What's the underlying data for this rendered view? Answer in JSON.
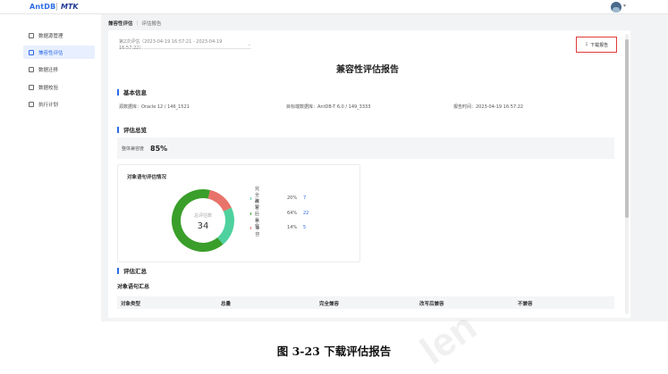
{
  "header": {
    "logo": "AntDB",
    "product": "MTK"
  },
  "sidebar": {
    "items": [
      {
        "label": "数据源管理",
        "icon": "database-icon",
        "active": false
      },
      {
        "label": "兼容性评估",
        "icon": "document-icon",
        "active": true
      },
      {
        "label": "数据迁移",
        "icon": "folder-icon",
        "active": false
      },
      {
        "label": "数据校验",
        "icon": "check-icon",
        "active": false
      },
      {
        "label": "执行计划",
        "icon": "calendar-icon",
        "active": false
      }
    ]
  },
  "breadcrumb": {
    "parent": "兼容性评估",
    "current": "评估报告"
  },
  "report": {
    "selector_value": "第2次评估（2023-04-19 16:57:21 - 2023-04-19 16:57:22）",
    "download_label": "下载报告",
    "title": "兼容性评估报告",
    "basic_info": {
      "heading": "基本信息",
      "source": "源数据库：Oracle 12 / 146_1521",
      "target": "目标端数据库：AntDB-T 6.0 / 149_3333",
      "time": "报告时间：2023-04-19 16:57:22"
    },
    "overview": {
      "heading": "评估总览",
      "score_label": "整体兼容度",
      "score_value": "85%"
    },
    "object_chart": {
      "title": "对象语句评估情况",
      "center_label": "总评估数",
      "center_value": "34",
      "legend": [
        {
          "label": "完全兼容",
          "percent": "20%",
          "count": "7",
          "color": "#4fd19e"
        },
        {
          "label": "改写后兼容",
          "percent": "64%",
          "count": "22",
          "color": "#3a9e2a"
        },
        {
          "label": "不兼容",
          "percent": "14%",
          "count": "5",
          "color": "#e8736a"
        }
      ]
    },
    "summary": {
      "heading": "评估汇总",
      "sub_heading": "对象语句汇总",
      "columns": [
        "对象类型",
        "总量",
        "完全兼容",
        "改写后兼容",
        "不兼容"
      ]
    }
  },
  "caption": "图 3-23  下载评估报告",
  "colors": {
    "accent": "#2d6ce8",
    "highlight_border": "#e03a3a"
  }
}
